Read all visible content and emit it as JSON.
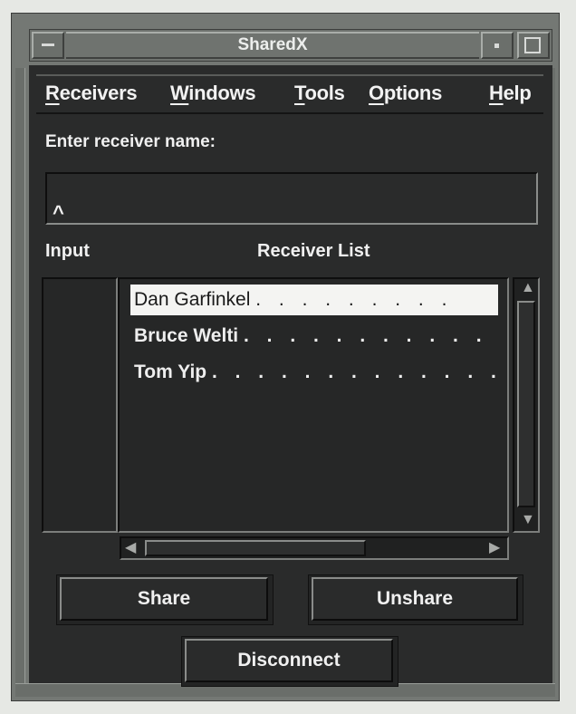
{
  "window": {
    "title": "SharedX"
  },
  "menubar": {
    "items": [
      {
        "label": "Receivers",
        "mnemonic": "R",
        "rest": "eceivers"
      },
      {
        "label": "Windows",
        "mnemonic": "W",
        "rest": "indows"
      },
      {
        "label": "Tools",
        "mnemonic": "T",
        "rest": "ools"
      },
      {
        "label": "Options",
        "mnemonic": "O",
        "rest": "ptions"
      },
      {
        "label": "Help",
        "mnemonic": "H",
        "rest": "elp"
      }
    ]
  },
  "form": {
    "prompt": "Enter receiver name:",
    "receiver_name_value": "",
    "caret_glyph": "^"
  },
  "columns": {
    "input_label": "Input",
    "list_label": "Receiver List"
  },
  "receivers": [
    {
      "name": "Dan Garfinkel",
      "dots": ". . . . . . . . .",
      "selected": true
    },
    {
      "name": "Bruce Welti",
      "dots": ". . . . . . . . . . .",
      "selected": false
    },
    {
      "name": "Tom Yip",
      "dots": ". . . . . . . . . . . . .",
      "selected": false
    }
  ],
  "buttons": {
    "share": "Share",
    "unshare": "Unshare",
    "disconnect": "Disconnect"
  },
  "icons": {
    "window_menu": "window-menu-icon",
    "minimize": "minimize-icon",
    "maximize": "maximize-icon",
    "scroll_up": "arrow-up-icon",
    "scroll_down": "arrow-down-icon",
    "scroll_left": "arrow-left-icon",
    "scroll_right": "arrow-right-icon"
  },
  "colors": {
    "client_bg": "#2a2b2b",
    "selection_bg": "#f4f4f2",
    "frame": "#747874"
  }
}
